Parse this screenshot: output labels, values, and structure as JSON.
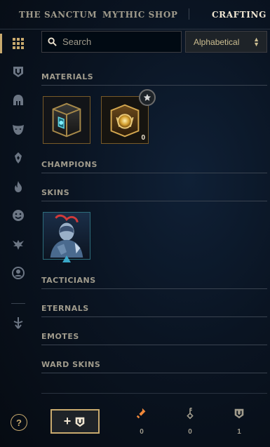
{
  "nav": {
    "tabs": [
      {
        "label": "THE SANCTUM"
      },
      {
        "label": "MYTHIC SHOP"
      },
      {
        "label": "CRAFTING"
      }
    ]
  },
  "search": {
    "placeholder": "Search",
    "value": ""
  },
  "sort": {
    "selected": "Alphabetical"
  },
  "sections": {
    "materials": "MATERIALS",
    "champions": "CHAMPIONS",
    "skins": "SKINS",
    "tacticians": "TACTICIANS",
    "eternals": "ETERNALS",
    "emotes": "EMOTES",
    "ward_skins": "WARD SKINS"
  },
  "materials": {
    "orb_count": "0"
  },
  "footer": {
    "add_label": "+",
    "orange_essence": "0",
    "keys": "0",
    "chests": "1"
  },
  "help": {
    "label": "?"
  },
  "colors": {
    "gold": "#c8aa6e",
    "orange_essence": "#f0883a",
    "rail_icon": "#6c7684"
  }
}
